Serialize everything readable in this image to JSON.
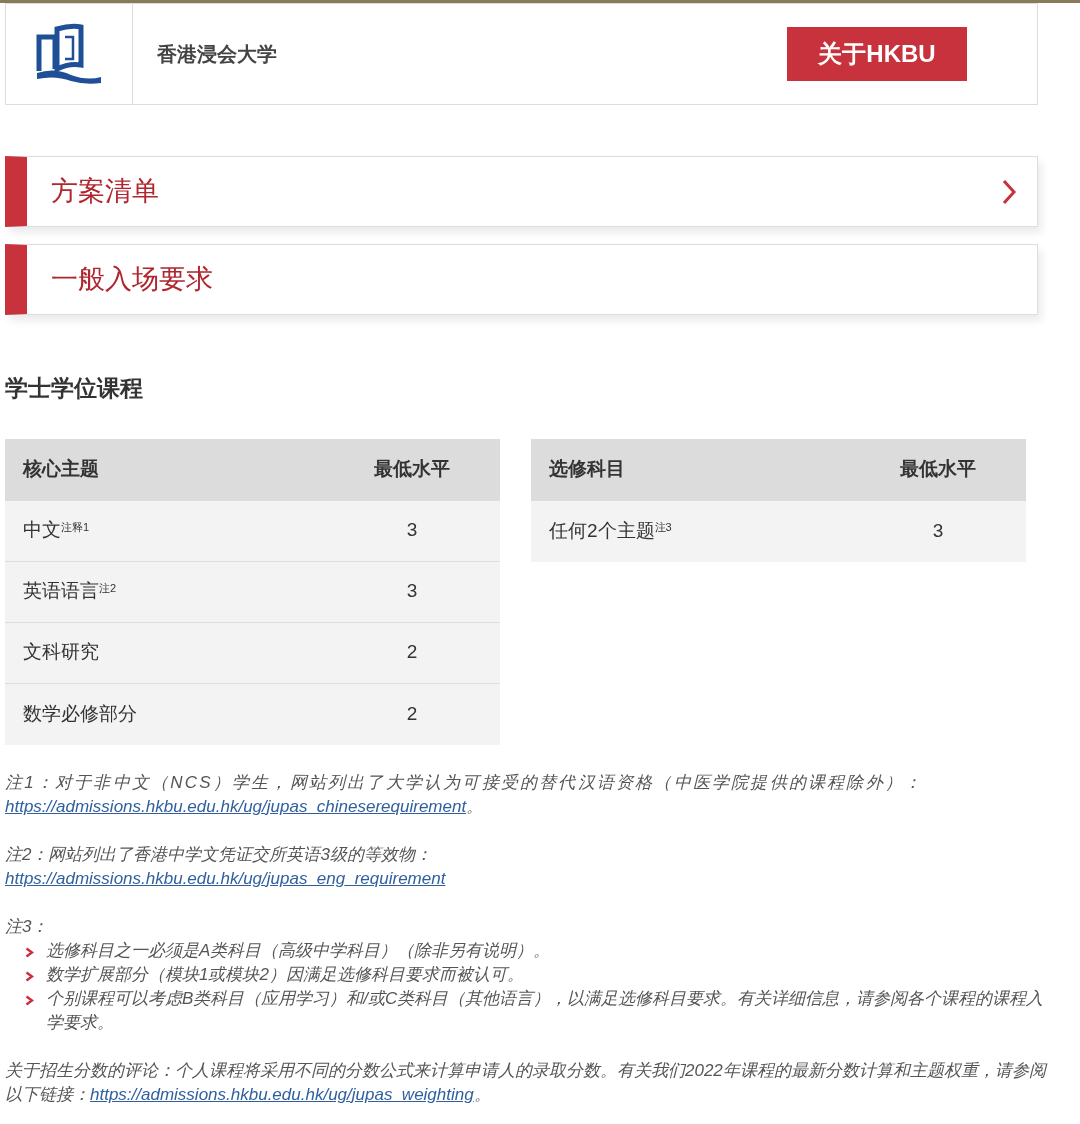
{
  "header": {
    "title": "香港浸会大学",
    "button": "关于HKBU"
  },
  "sections": [
    {
      "label": "方案清单",
      "kind": "link"
    },
    {
      "label": "一般入场要求",
      "kind": "plain"
    }
  ],
  "heading": "学士学位课程",
  "tables": [
    {
      "columns": [
        "核心主题",
        "最低水平"
      ],
      "rows": [
        [
          "中文$^{注释1}$",
          "3"
        ],
        [
          "英语语言$^{注2}$",
          "3"
        ],
        [
          "文科研究",
          "2"
        ],
        [
          "数学必修部分",
          "2"
        ]
      ]
    },
    {
      "columns": [
        "选修科目",
        "最低水平"
      ],
      "rows": [
        [
          "任何2个主题$^{注3}$",
          "3"
        ]
      ]
    }
  ],
  "notes": [
    {
      "text": "注1：对于非中文（NCS）学生，网站列出了大学认为可接受的替代汉语资格（中医学院提供的课程除外）：",
      "link": "https://admissions.hkbu.edu.hk/ug/jupas_chineserequirement",
      "after": "。",
      "spaced": true
    },
    {
      "text": "注2：网站列出了香港中学文凭证交所英语3级的等效物：",
      "link": "https://admissions.hkbu.edu.hk/ug/jupas_eng_requirement",
      "spaced": false
    }
  ],
  "note3": {
    "title": "注3：",
    "items": [
      "选修科目之一必须是A类科目（高级中学科目）（除非另有说明）。",
      "数学扩展部分（模块1或模块2）因满足选修科目要求而被认可。",
      "个别课程可以考虑B类科目（应用学习）和/或C类科目（其他语言），以满足选修科目要求。有关详细信息，请参阅各个课程的课程入学要求。"
    ]
  },
  "footer": {
    "text": "关于招生分数的评论：个人课程将采用不同的分数公式来计算申请人的录取分数。有关我们2022年课程的最新分数计算和主题权重，请参阅以下链接：",
    "link": "https://admissions.hkbu.edu.hk/ug/jupas_weighting",
    "after": "。"
  }
}
